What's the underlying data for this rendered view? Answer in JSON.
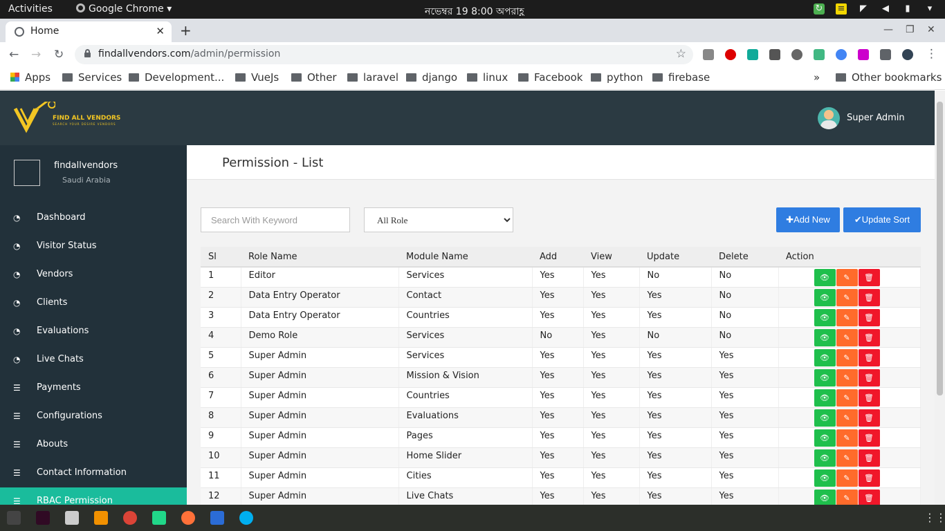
{
  "os": {
    "activities": "Activities",
    "app_menu": "Google Chrome",
    "datetime": "নভেম্বর 19  8:00 অপরাহ্ণ"
  },
  "browser": {
    "tab_title": "Home",
    "url_domain": "findallvendors.com",
    "url_path": "/admin/permission",
    "bookmarks": [
      "Apps",
      "Services",
      "Development...",
      "VueJs",
      "Other",
      "laravel",
      "django",
      "linux",
      "Facebook",
      "python",
      "firebase"
    ],
    "other_bookmarks": "Other bookmarks",
    "overflow": "»"
  },
  "header": {
    "logo_text": "FIND ALL VENDORS",
    "logo_tagline": "SEARCH YOUR DESIRE VENDORS",
    "admin_name": "Super Admin"
  },
  "sidebar": {
    "profile_name": "findallvendors",
    "profile_location": "Saudi Arabia",
    "items": [
      {
        "label": "Dashboard",
        "icon": "gauge-icon"
      },
      {
        "label": "Visitor Status",
        "icon": "gauge-icon"
      },
      {
        "label": "Vendors",
        "icon": "gauge-icon"
      },
      {
        "label": "Clients",
        "icon": "gauge-icon"
      },
      {
        "label": "Evaluations",
        "icon": "gauge-icon"
      },
      {
        "label": "Live Chats",
        "icon": "gauge-icon"
      },
      {
        "label": "Payments",
        "icon": "list-icon"
      },
      {
        "label": "Configurations",
        "icon": "list-icon"
      },
      {
        "label": "Abouts",
        "icon": "list-icon"
      },
      {
        "label": "Contact Information",
        "icon": "list-icon"
      },
      {
        "label": "RBAC Permission",
        "icon": "list-icon"
      }
    ],
    "active_index": 10
  },
  "main": {
    "title": "Permission - List",
    "search_placeholder": "Search With Keyword",
    "role_select_value": "All Role",
    "add_new_label": "✚Add New",
    "update_sort_label": "✔Update Sort",
    "columns": [
      "Sl",
      "Role Name",
      "Module Name",
      "Add",
      "View",
      "Update",
      "Delete",
      "Action"
    ],
    "rows": [
      [
        "1",
        "Editor",
        "Services",
        "Yes",
        "Yes",
        "No",
        "No"
      ],
      [
        "2",
        "Data Entry Operator",
        "Contact",
        "Yes",
        "Yes",
        "Yes",
        "No"
      ],
      [
        "3",
        "Data Entry Operator",
        "Countries",
        "Yes",
        "Yes",
        "Yes",
        "No"
      ],
      [
        "4",
        "Demo Role",
        "Services",
        "No",
        "Yes",
        "No",
        "No"
      ],
      [
        "5",
        "Super Admin",
        "Services",
        "Yes",
        "Yes",
        "Yes",
        "Yes"
      ],
      [
        "6",
        "Super Admin",
        "Mission & Vision",
        "Yes",
        "Yes",
        "Yes",
        "Yes"
      ],
      [
        "7",
        "Super Admin",
        "Countries",
        "Yes",
        "Yes",
        "Yes",
        "Yes"
      ],
      [
        "8",
        "Super Admin",
        "Evaluations",
        "Yes",
        "Yes",
        "Yes",
        "Yes"
      ],
      [
        "9",
        "Super Admin",
        "Pages",
        "Yes",
        "Yes",
        "Yes",
        "Yes"
      ],
      [
        "10",
        "Super Admin",
        "Home Slider",
        "Yes",
        "Yes",
        "Yes",
        "Yes"
      ],
      [
        "11",
        "Super Admin",
        "Cities",
        "Yes",
        "Yes",
        "Yes",
        "Yes"
      ],
      [
        "12",
        "Super Admin",
        "Live Chats",
        "Yes",
        "Yes",
        "Yes",
        "Yes"
      ]
    ],
    "action_icons": [
      "eye-icon",
      "pencil-icon",
      "trash-icon"
    ]
  },
  "colors": {
    "header_bg": "#2b3a42",
    "sidebar_bg": "#22313a",
    "active_item": "#1abc9c",
    "primary_button": "#2f7de1",
    "view_button": "#1fbf4c",
    "edit_button": "#ff6b2b",
    "delete_button": "#f0172a",
    "logo_yellow": "#f3c623"
  }
}
